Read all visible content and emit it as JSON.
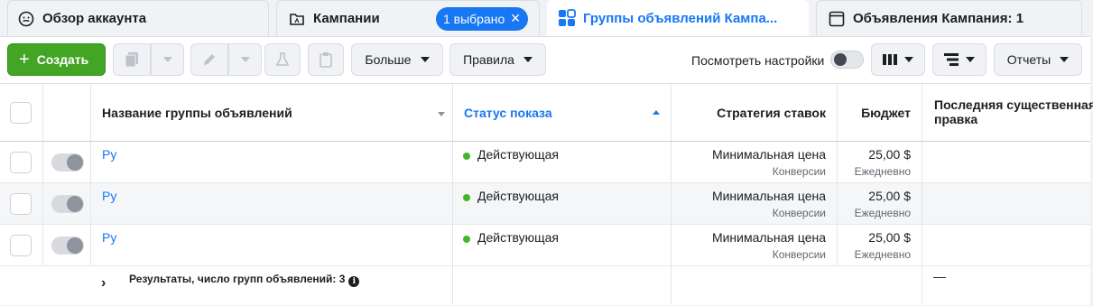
{
  "tabs": [
    {
      "label": "Обзор аккаунта",
      "icon": "account-overview-icon"
    },
    {
      "label": "Кампании",
      "icon": "campaign-folder-icon",
      "badge": "1 выбрано"
    },
    {
      "label": "Группы объявлений Кампа...",
      "icon": "ad-sets-grid-icon",
      "active": true
    },
    {
      "label": "Объявления Кампания: 1",
      "icon": "ads-window-icon"
    }
  ],
  "toolbar": {
    "create_label": "Создать",
    "more_label": "Больше",
    "rules_label": "Правила",
    "view_settings_label": "Посмотреть настройки",
    "reports_label": "Отчеты"
  },
  "table": {
    "headers": {
      "name": "Название группы объявлений",
      "status": "Статус показа",
      "bid": "Стратегия ставок",
      "budget": "Бюджет",
      "last_edit": "Последняя существенная правка"
    },
    "rows": [
      {
        "name": "Ру",
        "status": "Действующая",
        "bid": "Минимальная цена",
        "bid_sub": "Конверсии",
        "budget": "25,00 $",
        "budget_sub": "Ежедневно"
      },
      {
        "name": "Ру",
        "status": "Действующая",
        "bid": "Минимальная цена",
        "bid_sub": "Конверсии",
        "budget": "25,00 $",
        "budget_sub": "Ежедневно"
      },
      {
        "name": "Ру",
        "status": "Действующая",
        "bid": "Минимальная цена",
        "bid_sub": "Конверсии",
        "budget": "25,00 $",
        "budget_sub": "Ежедневно"
      }
    ],
    "footer": {
      "results_label": "Результаты, число групп объявлений: 3",
      "last_edit_value": "—"
    }
  },
  "colors": {
    "accent": "#1877f2",
    "create_button": "#42a524",
    "status_active": "#42b72a"
  }
}
